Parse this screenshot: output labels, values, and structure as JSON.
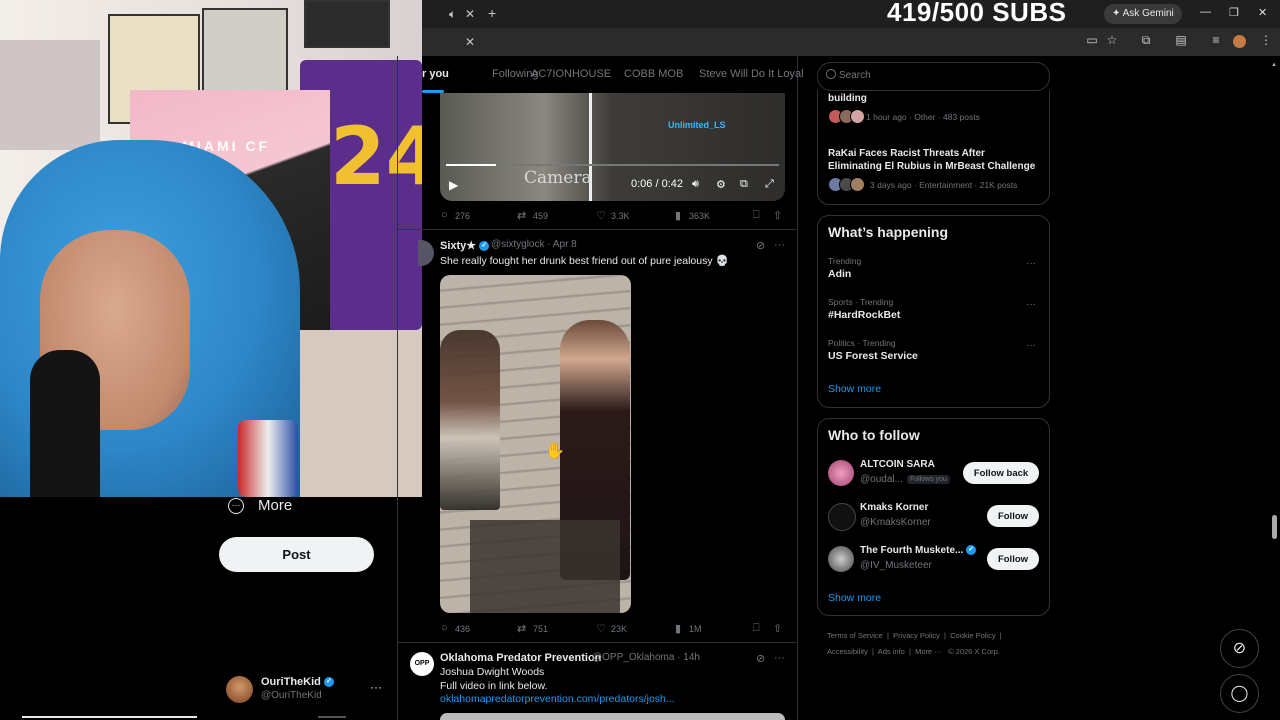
{
  "overlay": {
    "subs": "419/500 SUBS"
  },
  "browser": {
    "ask_gemini": "Ask Gemini",
    "new_tab": "+",
    "close_tab": "✕",
    "minimize": "—",
    "restore": "❐",
    "close": "✕"
  },
  "webcam": {
    "jersey_number": "24",
    "flag_text": "ER MIAMI CF"
  },
  "sidebar": {
    "more_label": "More",
    "post_label": "Post",
    "profile": {
      "name": "OuriTheKid",
      "handle": "@OuriTheKid"
    }
  },
  "feed": {
    "tabs": [
      "r you",
      "Following",
      "AC7IONHOUSE",
      "COBB MOB",
      "Steve Will Do It Loyal"
    ],
    "tweet1": {
      "video_time": "0:06 / 0:42",
      "overlay_text": "Camera",
      "watermark": "Unlimited_LS",
      "replies": "276",
      "reposts": "459",
      "likes": "3.3K",
      "views": "363K"
    },
    "tweet2": {
      "name": "Sixty★",
      "handle": "@sixtyglock · Apr 8",
      "text": "She really fought her drunk best friend out of pure jealousy 💀",
      "replies": "436",
      "reposts": "751",
      "likes": "23K",
      "views": "1M"
    },
    "tweet3": {
      "avatar_text": "OPP",
      "name": "Oklahoma Predator Prevention",
      "handle": "@OPP_Oklahoma · 14h",
      "line1": "Joshua Dwight Woods",
      "line2": "Full video in link below.",
      "link": "oklahomapredatorprevention.com/predators/josh..."
    }
  },
  "right": {
    "search_placeholder": "Search",
    "news": [
      {
        "title": "building",
        "meta": "1 hour ago · Other · 483 posts"
      },
      {
        "title_line1": "RaKai Faces Racist Threats After",
        "title_line2": "Eliminating El Rubius in MrBeast Challenge",
        "meta": "3 days ago · Entertainment · 21K posts"
      }
    ],
    "happening": {
      "heading": "What’s happening",
      "trends": [
        {
          "meta": "Trending",
          "name": "Adin"
        },
        {
          "meta": "Sports · Trending",
          "name": "#HardRockBet"
        },
        {
          "meta": "Politics · Trending",
          "name": "US Forest Service"
        }
      ],
      "show_more": "Show more"
    },
    "who_to_follow": {
      "heading": "Who to follow",
      "users": [
        {
          "name": "ALTCOIN SARA",
          "handle": "@oudal...",
          "badge": "Follows you",
          "button": "Follow back"
        },
        {
          "name": "Kmaks Korner",
          "handle": "@KmaksKorner",
          "button": "Follow"
        },
        {
          "name": "The Fourth Muskete...",
          "handle": "@IV_Musketeer",
          "button": "Follow"
        }
      ],
      "show_more": "Show more"
    },
    "footer": {
      "links": [
        "Terms of Service",
        "Privacy Policy",
        "Cookie Policy",
        "Accessibility",
        "Ads info",
        "More ···",
        "© 2026 X Corp."
      ]
    }
  },
  "colors": {
    "accent": "#1d9bf0",
    "background": "#000000",
    "text": "#e7e9ea",
    "muted": "#71767b"
  }
}
